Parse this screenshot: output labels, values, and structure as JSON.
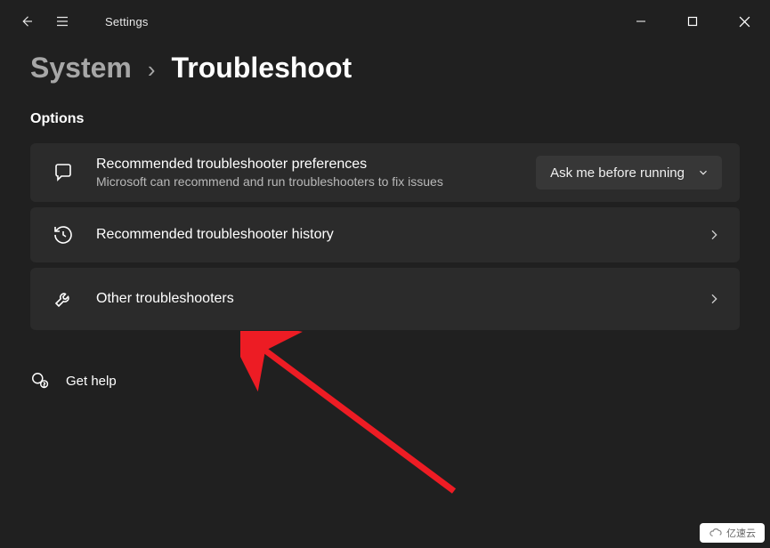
{
  "titlebar": {
    "app_title": "Settings"
  },
  "breadcrumb": {
    "parent": "System",
    "separator": "›",
    "current": "Troubleshoot"
  },
  "section": {
    "label": "Options"
  },
  "cards": {
    "pref": {
      "title": "Recommended troubleshooter preferences",
      "subtitle": "Microsoft can recommend and run troubleshooters to fix issues",
      "dropdown_value": "Ask me before running"
    },
    "history": {
      "title": "Recommended troubleshooter history"
    },
    "other": {
      "title": "Other troubleshooters"
    }
  },
  "help": {
    "label": "Get help"
  },
  "watermark": {
    "text": "亿速云"
  }
}
